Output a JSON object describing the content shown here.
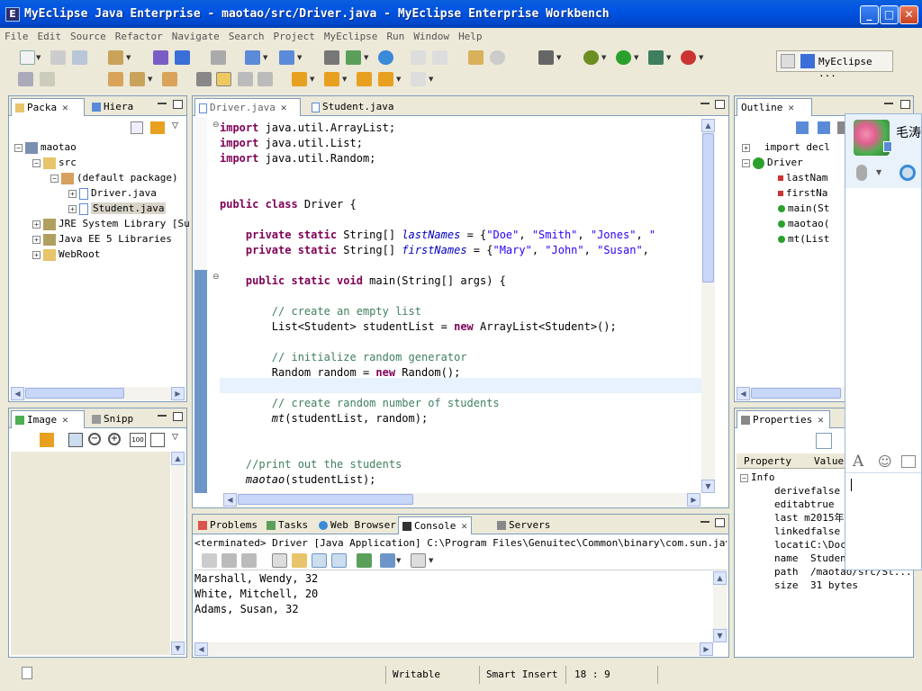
{
  "window": {
    "title": "MyEclipse Java Enterprise - maotao/src/Driver.java - MyEclipse Enterprise Workbench"
  },
  "menu": [
    "File",
    "Edit",
    "Source",
    "Refactor",
    "Navigate",
    "Search",
    "Project",
    "MyEclipse",
    "Run",
    "Window",
    "Help"
  ],
  "perspective": {
    "label": "MyEclipse ..."
  },
  "package_explorer": {
    "tabs": [
      {
        "label": "Packa"
      },
      {
        "label": "Hiera"
      }
    ],
    "tree": [
      {
        "label": "maotao",
        "expanded": true,
        "depth": 0
      },
      {
        "label": "src",
        "expanded": true,
        "depth": 1
      },
      {
        "label": "(default package)",
        "expanded": true,
        "depth": 2
      },
      {
        "label": "Driver.java",
        "expanded": false,
        "depth": 3
      },
      {
        "label": "Student.java",
        "expanded": false,
        "depth": 3,
        "selected": true
      },
      {
        "label": "JRE System Library [Su",
        "expanded": false,
        "depth": 1
      },
      {
        "label": "Java EE 5 Libraries",
        "expanded": false,
        "depth": 1
      },
      {
        "label": "WebRoot",
        "expanded": false,
        "depth": 1
      }
    ]
  },
  "image_panel": {
    "tabs": [
      {
        "label": "Image"
      },
      {
        "label": "Snipp"
      }
    ]
  },
  "editor": {
    "tabs": [
      {
        "label": "Driver.java"
      },
      {
        "label": "Student.java"
      }
    ]
  },
  "outline": {
    "tab": "Outline",
    "items": [
      {
        "label": "import decl",
        "depth": 0
      },
      {
        "label": "Driver",
        "depth": 0
      },
      {
        "label": "lastNam",
        "depth": 1
      },
      {
        "label": "firstNa",
        "depth": 1
      },
      {
        "label": "main(St",
        "depth": 1
      },
      {
        "label": "maotao(",
        "depth": 1
      },
      {
        "label": "mt(List",
        "depth": 1
      }
    ]
  },
  "properties": {
    "tab": "Properties",
    "headers": {
      "property": "Property",
      "value": "Value"
    },
    "group": "Info",
    "rows": [
      {
        "name": "derive",
        "value": "false"
      },
      {
        "name": "editab",
        "value": "true"
      },
      {
        "name": "last m",
        "value": "2015年"
      },
      {
        "name": "linked",
        "value": "false"
      },
      {
        "name": "locati",
        "value": "C:\\Doc"
      },
      {
        "name": "name",
        "value": "Studen"
      },
      {
        "name": "path",
        "value": "/maotao/src/St..."
      },
      {
        "name": "size",
        "value": "31  bytes"
      }
    ]
  },
  "bottom_panel": {
    "tabs": [
      {
        "label": "Problems"
      },
      {
        "label": "Tasks"
      },
      {
        "label": "Web Browser"
      },
      {
        "label": "Console"
      },
      {
        "label": "Servers"
      }
    ],
    "console_header": "<terminated> Driver [Java Application] C:\\Program Files\\Genuitec\\Common\\binary\\com.sun.java.jdk.win",
    "output": [
      "Marshall, Wendy, 32",
      "White, Mitchell, 20",
      "Adams, Susan, 32"
    ]
  },
  "chat_popup": {
    "name": "毛涛"
  },
  "status": {
    "writable": "Writable",
    "insert_mode": "Smart Insert",
    "position": "18 : 9"
  },
  "colors": {
    "keyword": "#7f0055",
    "string": "#2a00ff",
    "comment": "#3f7f5f",
    "field": "#0000c0",
    "title_bar": "#0054e3"
  }
}
